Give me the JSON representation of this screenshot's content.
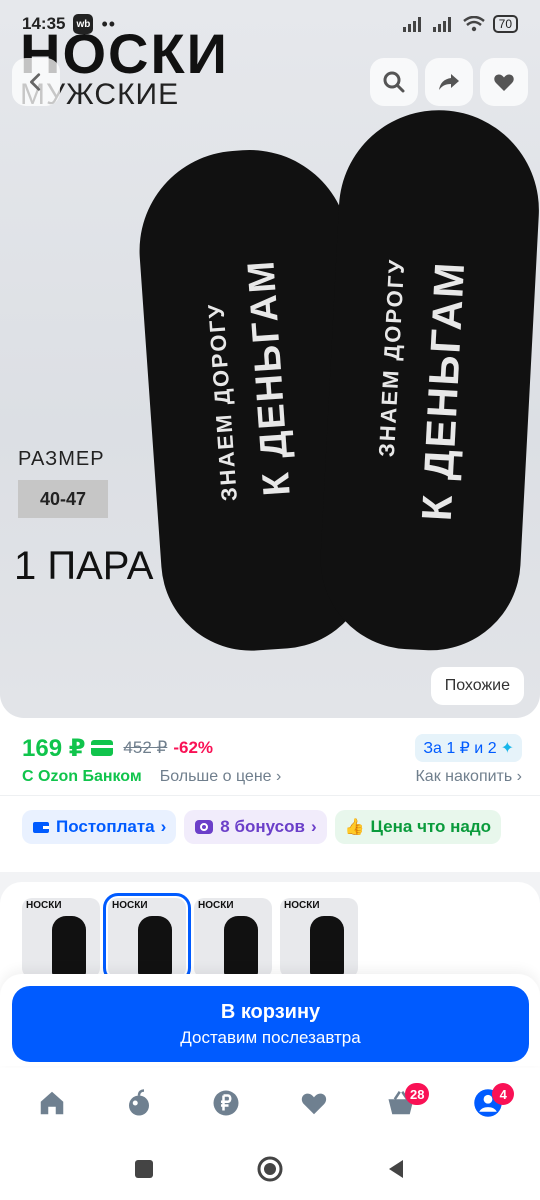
{
  "status_bar": {
    "time": "14:35",
    "app_badge": "wb",
    "dots": "••",
    "battery": "70"
  },
  "hero": {
    "brand": "НОСКИ",
    "subtitle": "МУЖСКИЕ",
    "size_label": "РАЗМЕР",
    "size_value": "40-47",
    "pairs": "1 ПАРА",
    "sock_text_small": "ЗНАЕМ ДОРОГУ",
    "sock_text_big": "К ДЕНЬГАМ",
    "similar_label": "Похожие"
  },
  "price": {
    "current": "169 ₽",
    "old": "452 ₽",
    "discount": "-62%",
    "points": "За 1 ₽ и 2",
    "bank": "С Ozon Банком",
    "more_about_price": "Больше о цене",
    "how_to_save": "Как накопить"
  },
  "chips": [
    {
      "label": "Постоплата"
    },
    {
      "label": "8 бонусов"
    },
    {
      "label": "Цена что надо"
    }
  ],
  "gallery": {
    "thumbs": [
      {
        "title": "НОСКИ"
      },
      {
        "title": "НОСКИ"
      },
      {
        "title": "НОСКИ"
      },
      {
        "title": "НОСКИ"
      }
    ],
    "selected_index": 1
  },
  "cart": {
    "title": "В корзину",
    "subtitle": "Доставим послезавтра"
  },
  "bottom_nav": {
    "items": [
      {
        "icon": "home-icon"
      },
      {
        "icon": "fresh-icon"
      },
      {
        "icon": "ruble-icon"
      },
      {
        "icon": "heart-icon"
      },
      {
        "icon": "basket-icon",
        "badge": "28"
      },
      {
        "icon": "profile-icon",
        "badge": "4"
      }
    ]
  },
  "colors": {
    "accent": "#005bff",
    "green": "#10c44c",
    "discount": "#f91155"
  }
}
